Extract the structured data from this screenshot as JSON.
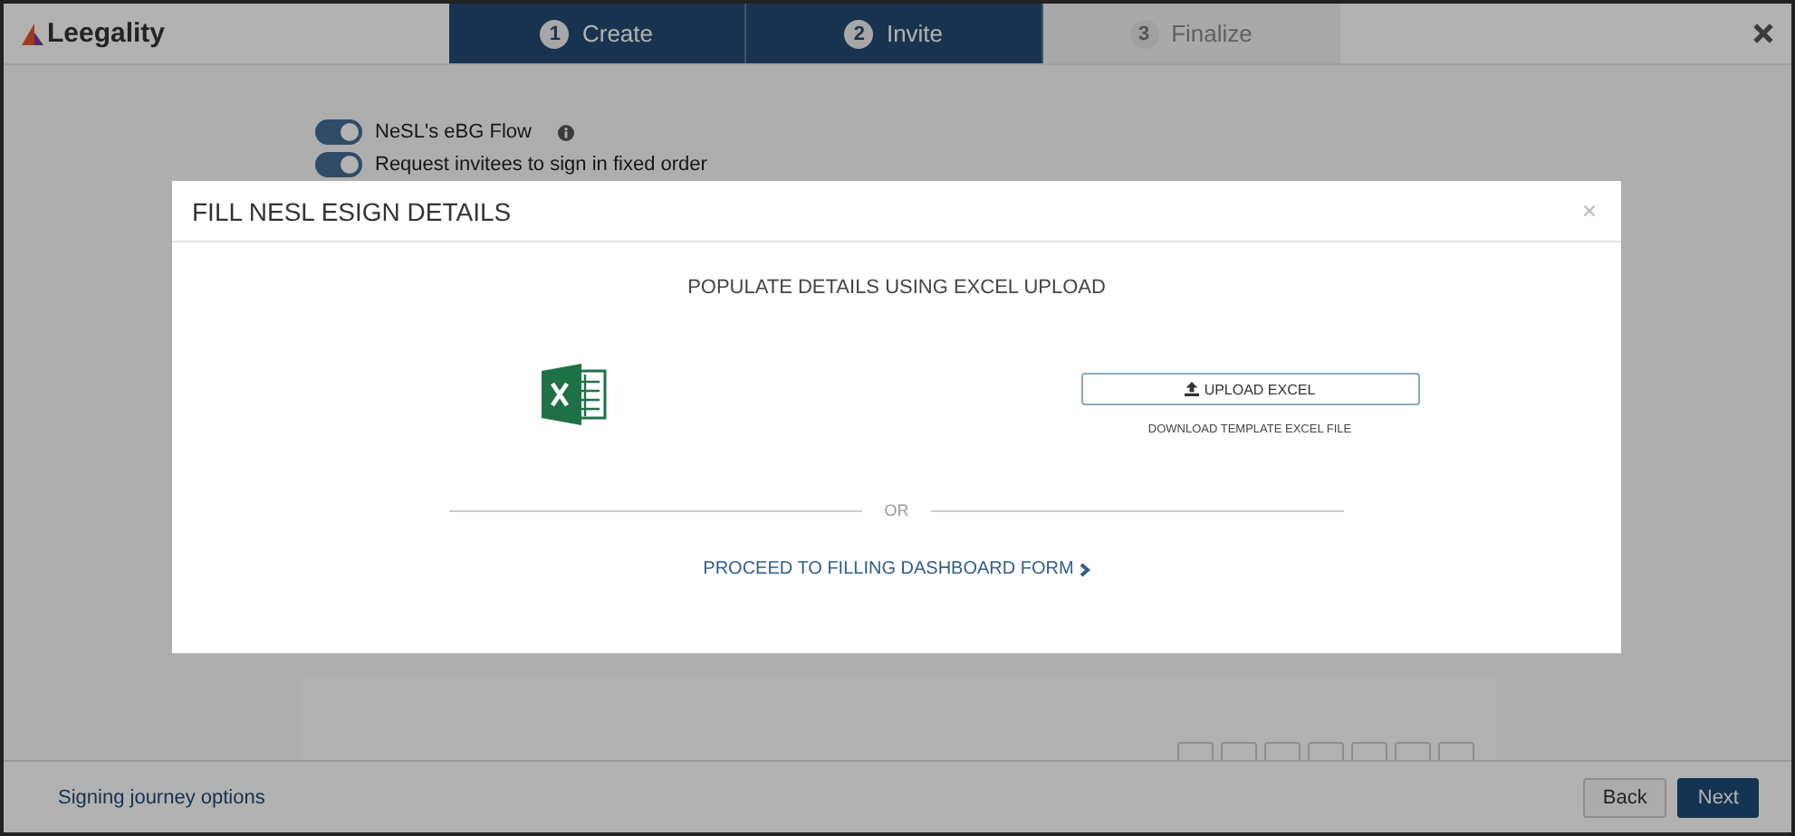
{
  "header": {
    "logo": "Leegality",
    "steps": [
      {
        "number": "1",
        "label": "Create",
        "active": true
      },
      {
        "number": "2",
        "label": "Invite",
        "active": true
      },
      {
        "number": "3",
        "label": "Finalize",
        "active": false
      }
    ]
  },
  "options": [
    {
      "label": "NeSL's eBG Flow",
      "on": true,
      "info": true
    },
    {
      "label": "Request invitees to sign in fixed order",
      "on": true,
      "info": false
    }
  ],
  "modal": {
    "title": "FILL NESL ESIGN DETAILS",
    "subtitle": "POPULATE DETAILS USING EXCEL UPLOAD",
    "upload_button": "UPLOAD EXCEL",
    "template_link": "DOWNLOAD TEMPLATE EXCEL FILE",
    "divider": "OR",
    "proceed_link": "PROCEED TO FILLING DASHBOARD FORM"
  },
  "footer": {
    "link": "Signing journey options",
    "buttons": [
      {
        "label": "Back",
        "primary": false
      },
      {
        "label": "Next",
        "primary": true
      }
    ]
  }
}
